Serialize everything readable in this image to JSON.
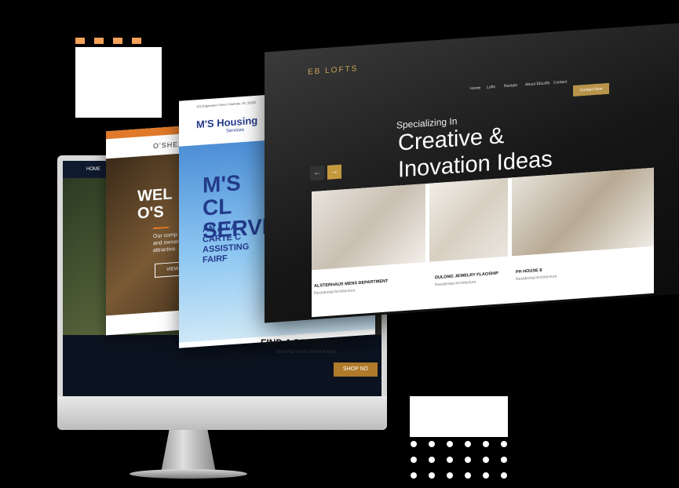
{
  "monitor_site": {
    "nav_home": "HOME",
    "find_title": "FIND A PROPERTY",
    "find_sub": "BROWSE YOUR DREAM HOUSE",
    "shop_label": "SHOP NO"
  },
  "oshea_site": {
    "logo": "O'SHEA",
    "welcome": "WEL",
    "welcome2": "O'S",
    "body": "Our comp",
    "body2": "and owner",
    "body3": "attractive",
    "view_button": "VIEW"
  },
  "ms_site": {
    "address": "123 Edgewater Street Charlotte, NC 28262",
    "logo_main": "M'S Housing",
    "logo_sub": "Services",
    "headline": "M'S CL SERVIC",
    "subline": "AN A LA CARTE C ASSISTING FAIRF"
  },
  "eb_site": {
    "logo": "EB LOFTS",
    "nav": [
      "Home",
      "Lofts",
      "Rentals",
      "About EbLofts",
      "Contact"
    ],
    "cta": "Contact Now",
    "eyebrow": "Specializing In",
    "headline_line1": "Creative &",
    "headline_line2": "Inovation Ideas",
    "projects": [
      {
        "title": "ALSTERHAUS MENS DEPARTMENT",
        "category": "Residential Architecture"
      },
      {
        "title": "DULONG JEWELRY FLAGSHIP",
        "category": "Residential Architecture"
      },
      {
        "title": "PH HOUSE 8",
        "category": "Residential Architecture"
      }
    ]
  },
  "colors": {
    "accent_orange": "#f5a25a",
    "eb_gold": "#b8934a",
    "ms_blue": "#233a8a"
  }
}
